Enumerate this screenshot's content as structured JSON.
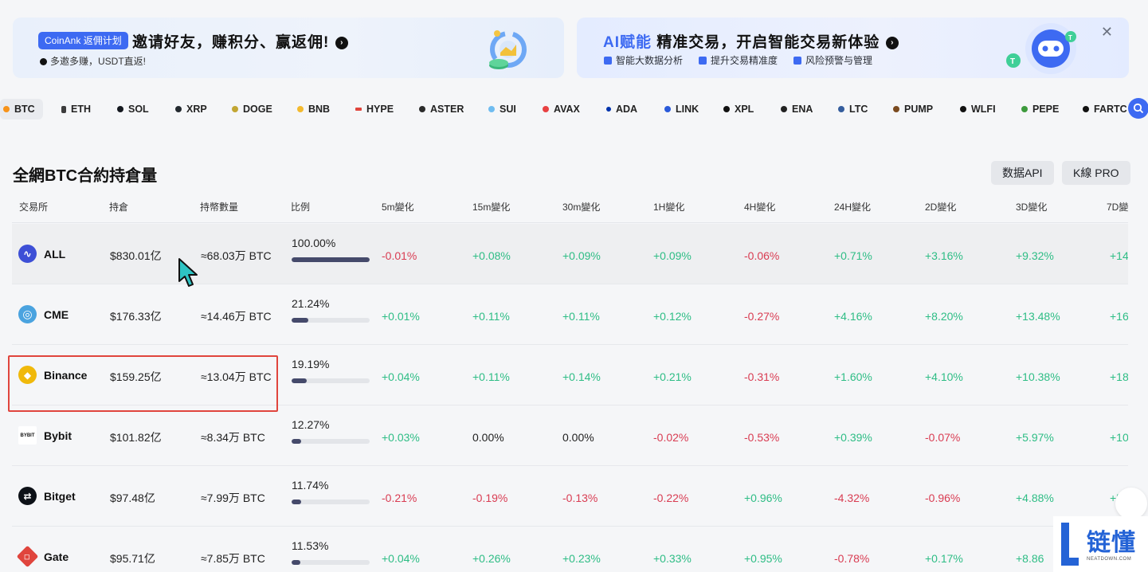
{
  "banner_left": {
    "pill": "CoinAnk 返佣计划",
    "title": "邀请好友，赚积分、赢返佣!",
    "subtitle": "多邀多赚，USDT直返!"
  },
  "banner_right": {
    "title_ai": "AI赋能",
    "title_rest": "精准交易，开启智能交易新体验",
    "features": [
      "智能大数据分析",
      "提升交易精准度",
      "风险预警与管理"
    ],
    "close": "✕"
  },
  "coins": [
    {
      "label": "BTC",
      "color": "#f7931a"
    },
    {
      "label": "ETH",
      "color": "#3c3c3d"
    },
    {
      "label": "SOL",
      "color": "#14181f"
    },
    {
      "label": "XRP",
      "color": "#23292f"
    },
    {
      "label": "DOGE",
      "color": "#c2a633"
    },
    {
      "label": "BNB",
      "color": "#f3ba2f"
    },
    {
      "label": "HYPE",
      "color": "#e0453d"
    },
    {
      "label": "ASTER",
      "color": "#2b2b2b"
    },
    {
      "label": "SUI",
      "color": "#6fbcf0"
    },
    {
      "label": "AVAX",
      "color": "#e84142"
    },
    {
      "label": "ADA",
      "color": "#0033ad"
    },
    {
      "label": "LINK",
      "color": "#2a5ada"
    },
    {
      "label": "XPL",
      "color": "#111111"
    },
    {
      "label": "ENA",
      "color": "#222222"
    },
    {
      "label": "LTC",
      "color": "#345d9d"
    },
    {
      "label": "PUMP",
      "color": "#7a4a1f"
    },
    {
      "label": "WLFI",
      "color": "#111111"
    },
    {
      "label": "PEPE",
      "color": "#3d9a3d"
    },
    {
      "label": "FARTC",
      "color": "#111111"
    }
  ],
  "section": {
    "title": "全網BTC合約持倉量",
    "btn_api": "数据API",
    "btn_kline": "K線 PRO"
  },
  "table": {
    "headers": [
      "交易所",
      "持倉",
      "持幣數量",
      "比例",
      "5m變化",
      "15m變化",
      "30m變化",
      "1H變化",
      "4H變化",
      "24H變化",
      "2D變化",
      "3D變化",
      "7D變"
    ],
    "rows": [
      {
        "exchange": "ALL",
        "logo_color": "#3d4fd6",
        "oi": "$830.01亿",
        "qty": "≈68.03万 BTC",
        "ratio": "100.00%",
        "ratio_pct": 100,
        "changes": [
          "-0.01%",
          "+0.08%",
          "+0.09%",
          "+0.09%",
          "-0.06%",
          "+0.71%",
          "+3.16%",
          "+9.32%",
          "+14"
        ]
      },
      {
        "exchange": "CME",
        "logo_color": "#4aa3df",
        "oi": "$176.33亿",
        "qty": "≈14.46万 BTC",
        "ratio": "21.24%",
        "ratio_pct": 21.24,
        "changes": [
          "+0.01%",
          "+0.11%",
          "+0.11%",
          "+0.12%",
          "-0.27%",
          "+4.16%",
          "+8.20%",
          "+13.48%",
          "+16"
        ]
      },
      {
        "exchange": "Binance",
        "logo_color": "#f0b90b",
        "oi": "$159.25亿",
        "qty": "≈13.04万 BTC",
        "ratio": "19.19%",
        "ratio_pct": 19.19,
        "changes": [
          "+0.04%",
          "+0.11%",
          "+0.14%",
          "+0.21%",
          "-0.31%",
          "+1.60%",
          "+4.10%",
          "+10.38%",
          "+18"
        ]
      },
      {
        "exchange": "Bybit",
        "logo_color": "#ffffff",
        "oi": "$101.82亿",
        "qty": "≈8.34万 BTC",
        "ratio": "12.27%",
        "ratio_pct": 12.27,
        "changes": [
          "+0.03%",
          "0.00%",
          "0.00%",
          "-0.02%",
          "-0.53%",
          "+0.39%",
          "-0.07%",
          "+5.97%",
          "+10"
        ]
      },
      {
        "exchange": "Bitget",
        "logo_color": "#0d1117",
        "oi": "$97.48亿",
        "qty": "≈7.99万 BTC",
        "ratio": "11.74%",
        "ratio_pct": 11.74,
        "changes": [
          "-0.21%",
          "-0.19%",
          "-0.13%",
          "-0.22%",
          "+0.96%",
          "-4.32%",
          "-0.96%",
          "+4.88%",
          "+5.3"
        ]
      },
      {
        "exchange": "Gate",
        "logo_color": "#e0453d",
        "oi": "$95.71亿",
        "qty": "≈7.85万 BTC",
        "ratio": "11.53%",
        "ratio_pct": 11.53,
        "changes": [
          "+0.04%",
          "+0.26%",
          "+0.23%",
          "+0.33%",
          "+0.95%",
          "-0.78%",
          "+0.17%",
          "+8.86",
          ""
        ]
      }
    ]
  },
  "watermark": {
    "text": "链懂",
    "sub": "NEATDOWN.COM"
  }
}
